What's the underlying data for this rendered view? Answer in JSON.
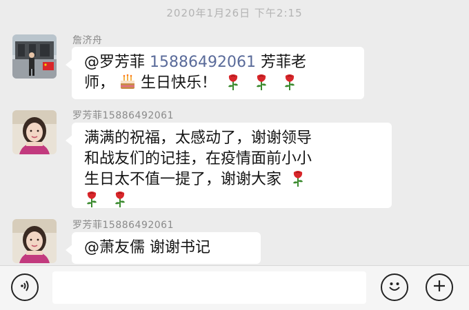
{
  "timestamp": "2020年1月26日 下午2:15",
  "messages": [
    {
      "sender": "詹济舟",
      "avatar": "photo-avatar-man-with-flag",
      "text": {
        "mention": "@罗芳菲",
        "phone": "15886492061",
        "after_phone": " 芳菲老",
        "line2_a": "师，",
        "cake_emoji": "birthday-cake",
        "line2_b": "生日快乐！",
        "roses": 3
      }
    },
    {
      "sender": "罗芳菲15886492061",
      "avatar": "photo-avatar-woman",
      "text": {
        "line1": "满满的祝福，太感动了，谢谢领导",
        "line2": "和战友们的记挂，在疫情面前小小",
        "line3": "生日太不值一提了，谢谢大家",
        "roses": 3
      }
    },
    {
      "sender": "罗芳菲15886492061",
      "avatar": "photo-avatar-woman",
      "text": {
        "line1": "@萧友儒 谢谢书记"
      }
    }
  ],
  "input_bar": {
    "voice_icon": "voice-icon",
    "input_value": "",
    "emoji_icon": "emoji-icon",
    "plus_icon": "plus-icon"
  },
  "colors": {
    "background": "#ececec",
    "bubble": "#ffffff",
    "phone_link": "#5a6b9a",
    "rose": "#d8262a",
    "stem": "#3a8a2e"
  }
}
